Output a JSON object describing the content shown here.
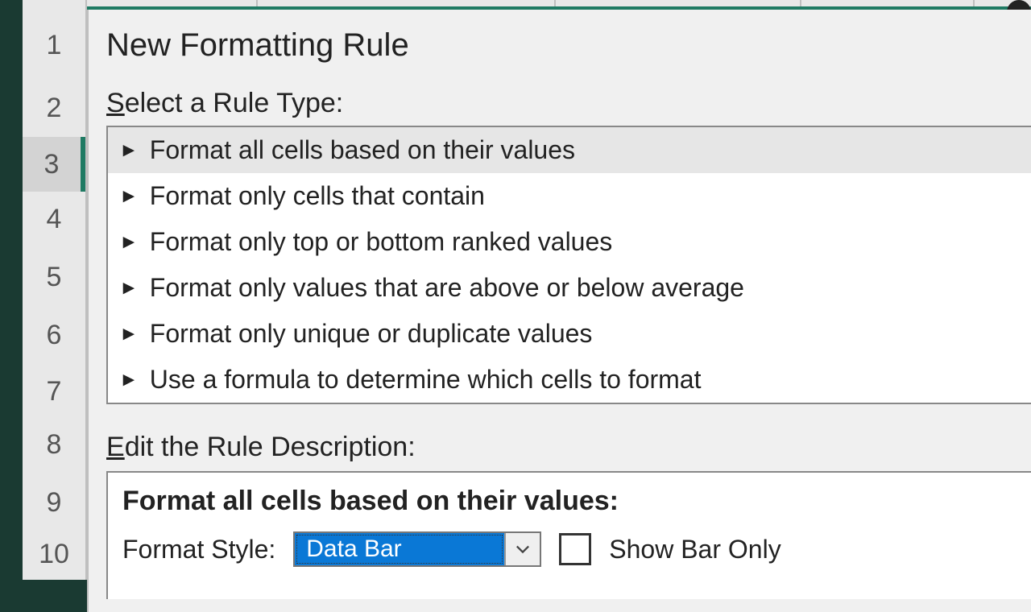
{
  "row_numbers": [
    "1",
    "2",
    "3",
    "4",
    "5",
    "6",
    "7",
    "8",
    "9",
    "10"
  ],
  "selected_row_index": 2,
  "dialog": {
    "title": "New Formatting Rule",
    "select_label_pre": "S",
    "select_label_rest": "elect a Rule Type:",
    "rule_types": [
      "Format all cells based on their values",
      "Format only cells that contain",
      "Format only top or bottom ranked values",
      "Format only values that are above or below average",
      "Format only unique or duplicate values",
      "Use a formula to determine which cells to format"
    ],
    "selected_rule_index": 0,
    "edit_label_pre": "E",
    "edit_label_rest": "dit the Rule Description:",
    "desc_heading": "Format all cells based on their values:",
    "format_style_label": "Format Style:",
    "format_style_value": "Data Bar",
    "show_bar_only_label": "Show Bar Only"
  }
}
